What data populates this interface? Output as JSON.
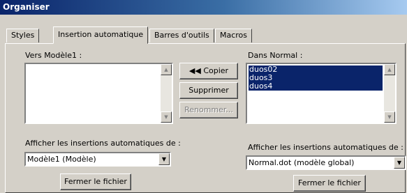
{
  "window": {
    "title": "Organiser"
  },
  "tabs": [
    {
      "label": "Styles",
      "active": false
    },
    {
      "label": "Insertion automatique",
      "active": true
    },
    {
      "label": "Barres d'outils",
      "active": false
    },
    {
      "label": "Macros",
      "active": false
    }
  ],
  "left": {
    "label": "Vers Modèle1 :",
    "items": [],
    "show_label": "Afficher les insertions automatiques de :",
    "source_value": "Modèle1 (Modèle)",
    "close_button": "Fermer le fichier"
  },
  "right": {
    "label": "Dans Normal :",
    "items": [
      "duos02",
      "duos3",
      "duos4"
    ],
    "show_label": "Afficher les insertions automatiques de :",
    "source_value": "Normal.dot (modèle global)",
    "close_button": "Fermer le fichier"
  },
  "actions": {
    "copy": "◀◀ Copier",
    "delete": "Supprimer",
    "rename": "Renommer..."
  },
  "icons": {
    "scroll_up": "scroll-up-arrow-icon",
    "scroll_down": "scroll-down-arrow-icon",
    "dropdown": "dropdown-arrow-icon"
  },
  "colors": {
    "title_bar": "#0a246a",
    "selection": "#0a246a",
    "face": "#d4d0c8"
  }
}
